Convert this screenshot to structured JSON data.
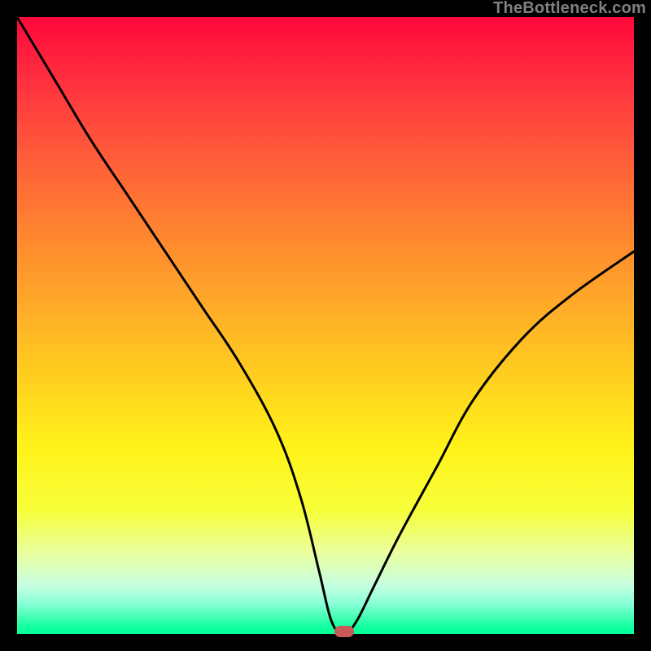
{
  "watermark": "TheBottleneck.com",
  "chart_data": {
    "type": "line",
    "title": "",
    "xlabel": "",
    "ylabel": "",
    "xlim": [
      0,
      100
    ],
    "ylim": [
      0,
      100
    ],
    "x": [
      0,
      6,
      12,
      18,
      24,
      30,
      36,
      42,
      46,
      49,
      51,
      53,
      55,
      58,
      62,
      68,
      74,
      82,
      90,
      100
    ],
    "values": [
      100,
      90,
      80,
      71,
      62,
      53,
      44,
      33,
      22,
      10,
      2,
      0,
      2,
      8,
      16,
      27,
      38,
      48,
      55,
      62
    ],
    "marker": {
      "x": 53,
      "y": 0
    },
    "gradient_stops": [
      {
        "pos": 0,
        "color": "#ff073a"
      },
      {
        "pos": 0.25,
        "color": "#ff7a33"
      },
      {
        "pos": 0.55,
        "color": "#ffd21f"
      },
      {
        "pos": 0.8,
        "color": "#f7ff3a"
      },
      {
        "pos": 1.0,
        "color": "#05ff98"
      }
    ]
  }
}
